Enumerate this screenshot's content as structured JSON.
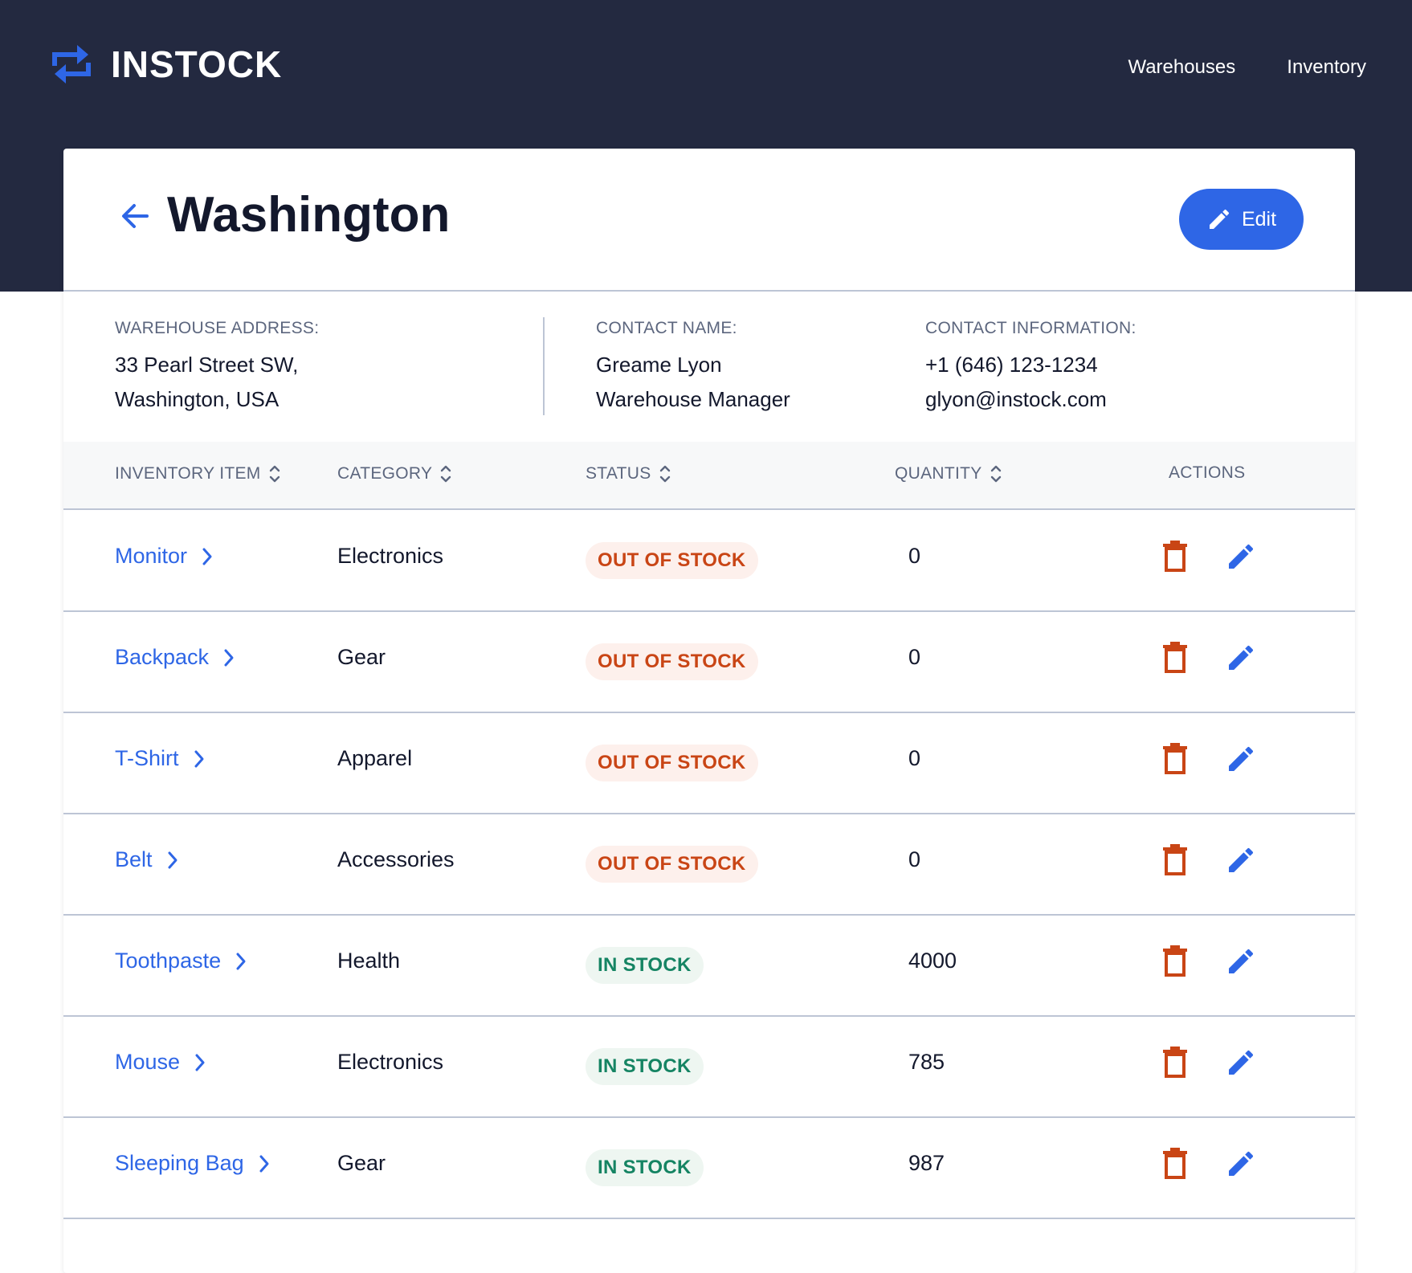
{
  "brand": {
    "name": "INSTOCK",
    "colors": {
      "navy": "#232940",
      "accent": "#2e66e6",
      "danger": "#c94515",
      "success": "#158463",
      "slate": "#5c667e",
      "border": "#bdc5d5"
    }
  },
  "nav": {
    "items": [
      {
        "label": "Warehouses"
      },
      {
        "label": "Inventory"
      }
    ]
  },
  "header": {
    "title": "Washington",
    "back_icon": "arrow-left-icon",
    "edit_label": "Edit",
    "edit_icon": "pencil-icon"
  },
  "details": {
    "address_label": "WAREHOUSE ADDRESS:",
    "address_line1": "33 Pearl Street SW,",
    "address_line2": "Washington, USA",
    "contact_label": "CONTACT NAME:",
    "contact_name": "Greame Lyon",
    "contact_position": "Warehouse Manager",
    "info_label": "CONTACT INFORMATION:",
    "phone": "+1 (646) 123-1234",
    "email": "glyon@instock.com"
  },
  "table": {
    "columns": [
      {
        "label": "INVENTORY ITEM",
        "sortable": true
      },
      {
        "label": "CATEGORY",
        "sortable": true
      },
      {
        "label": "STATUS",
        "sortable": true
      },
      {
        "label": "QUANTITY",
        "sortable": true
      },
      {
        "label": "ACTIONS",
        "sortable": false
      }
    ],
    "rows": [
      {
        "item": "Monitor",
        "category": "Electronics",
        "status": "OUT OF STOCK",
        "in_stock": false,
        "quantity": "0"
      },
      {
        "item": "Backpack",
        "category": "Gear",
        "status": "OUT OF STOCK",
        "in_stock": false,
        "quantity": "0"
      },
      {
        "item": "T-Shirt",
        "category": "Apparel",
        "status": "OUT OF STOCK",
        "in_stock": false,
        "quantity": "0"
      },
      {
        "item": "Belt",
        "category": "Accessories",
        "status": "OUT OF STOCK",
        "in_stock": false,
        "quantity": "0"
      },
      {
        "item": "Toothpaste",
        "category": "Health",
        "status": "IN STOCK",
        "in_stock": true,
        "quantity": "4000"
      },
      {
        "item": "Mouse",
        "category": "Electronics",
        "status": "IN STOCK",
        "in_stock": true,
        "quantity": "785"
      },
      {
        "item": "Sleeping Bag",
        "category": "Gear",
        "status": "IN STOCK",
        "in_stock": true,
        "quantity": "987"
      }
    ]
  }
}
